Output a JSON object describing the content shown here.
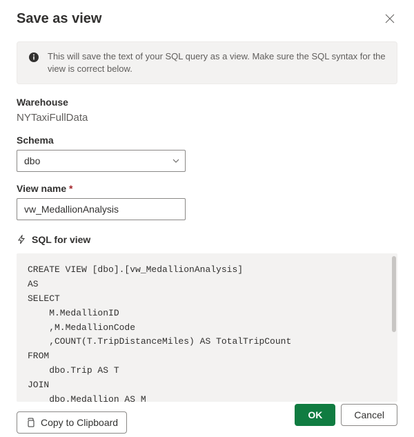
{
  "dialog": {
    "title": "Save as view",
    "info_message": "This will save the text of your SQL query as a view. Make sure the SQL syntax for the view is correct below."
  },
  "warehouse": {
    "label": "Warehouse",
    "value": "NYTaxiFullData"
  },
  "schema": {
    "label": "Schema",
    "value": "dbo"
  },
  "view_name": {
    "label": "View name",
    "required_mark": "*",
    "value": "vw_MedallionAnalysis"
  },
  "sql_section": {
    "label": "SQL for view",
    "code": "CREATE VIEW [dbo].[vw_MedallionAnalysis]\nAS\nSELECT\n    M.MedallionID\n    ,M.MedallionCode\n    ,COUNT(T.TripDistanceMiles) AS TotalTripCount\nFROM\n    dbo.Trip AS T\nJOIN\n    dbo.Medallion AS M"
  },
  "buttons": {
    "copy": "Copy to Clipboard",
    "ok": "OK",
    "cancel": "Cancel"
  }
}
